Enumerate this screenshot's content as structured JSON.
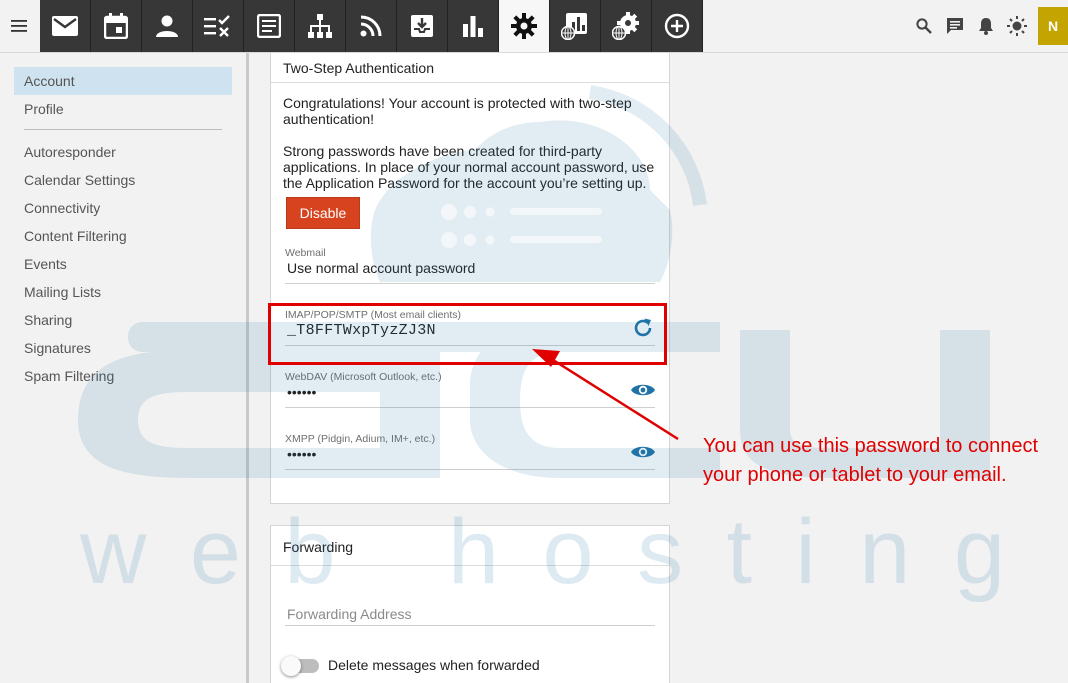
{
  "topbar": {
    "apps": [
      {
        "icon": "mail-icon",
        "name": "app-mail"
      },
      {
        "icon": "calendar-icon",
        "name": "app-calendar"
      },
      {
        "icon": "contacts-icon",
        "name": "app-contacts"
      },
      {
        "icon": "tasks-icon",
        "name": "app-tasks"
      },
      {
        "icon": "notes-icon",
        "name": "app-notes"
      },
      {
        "icon": "network-icon",
        "name": "app-network"
      },
      {
        "icon": "rss-icon",
        "name": "app-feeds"
      },
      {
        "icon": "archive-icon",
        "name": "app-archive"
      },
      {
        "icon": "bar-chart-icon",
        "name": "app-reports"
      },
      {
        "icon": "gear-icon",
        "name": "app-settings",
        "active": true
      },
      {
        "icon": "domain-reports-icon",
        "name": "app-domain-reports"
      },
      {
        "icon": "domain-settings-icon",
        "name": "app-domain-settings"
      },
      {
        "icon": "plus-circle-icon",
        "name": "app-add"
      }
    ],
    "tools": [
      "search-icon",
      "chat-icon",
      "bell-icon",
      "theme-icon"
    ],
    "avatar_initial": "N"
  },
  "sidebar": {
    "items": [
      {
        "label": "Account",
        "selected": true
      },
      {
        "label": "Profile"
      },
      {
        "label": "Autoresponder"
      },
      {
        "label": "Calendar Settings"
      },
      {
        "label": "Connectivity"
      },
      {
        "label": "Content Filtering"
      },
      {
        "label": "Events"
      },
      {
        "label": "Mailing Lists"
      },
      {
        "label": "Sharing"
      },
      {
        "label": "Signatures"
      },
      {
        "label": "Spam Filtering"
      }
    ]
  },
  "two_step": {
    "title": "Two-Step Authentication",
    "congrats": "Congratulations! Your account is protected with two-step authentication!",
    "info": "Strong passwords have been created for third-party applications. In place of your normal account password, use the Application Password for the account you’re setting up.",
    "disable_label": "Disable",
    "fields": [
      {
        "label": "Webmail",
        "value": "Use normal account password"
      },
      {
        "label": "IMAP/POP/SMTP (Most email clients)",
        "value": "_T8FFTWxpTyzZJ3N",
        "icon": "refresh-icon"
      },
      {
        "label": "WebDAV (Microsoft Outlook, etc.)",
        "value": "••••••",
        "icon": "eye-icon"
      },
      {
        "label": "XMPP (Pidgin, Adium, IM+, etc.)",
        "value": "••••••",
        "icon": "eye-icon"
      }
    ]
  },
  "forwarding": {
    "title": "Forwarding",
    "address_placeholder": "Forwarding Address",
    "toggle_label": "Delete messages when forwarded",
    "toggle_on": false
  },
  "annotation": {
    "text": "You can use this password to connect your phone or tablet to your email."
  },
  "colors": {
    "accent_blue": "#1f73a6",
    "disable_button": "#d6431e",
    "annotation_red": "#e00000",
    "selected_nav": "#cfe2f0",
    "avatar_bg": "#c4a400"
  },
  "watermark": {
    "brand": "accu",
    "tagline": "web hosting"
  }
}
